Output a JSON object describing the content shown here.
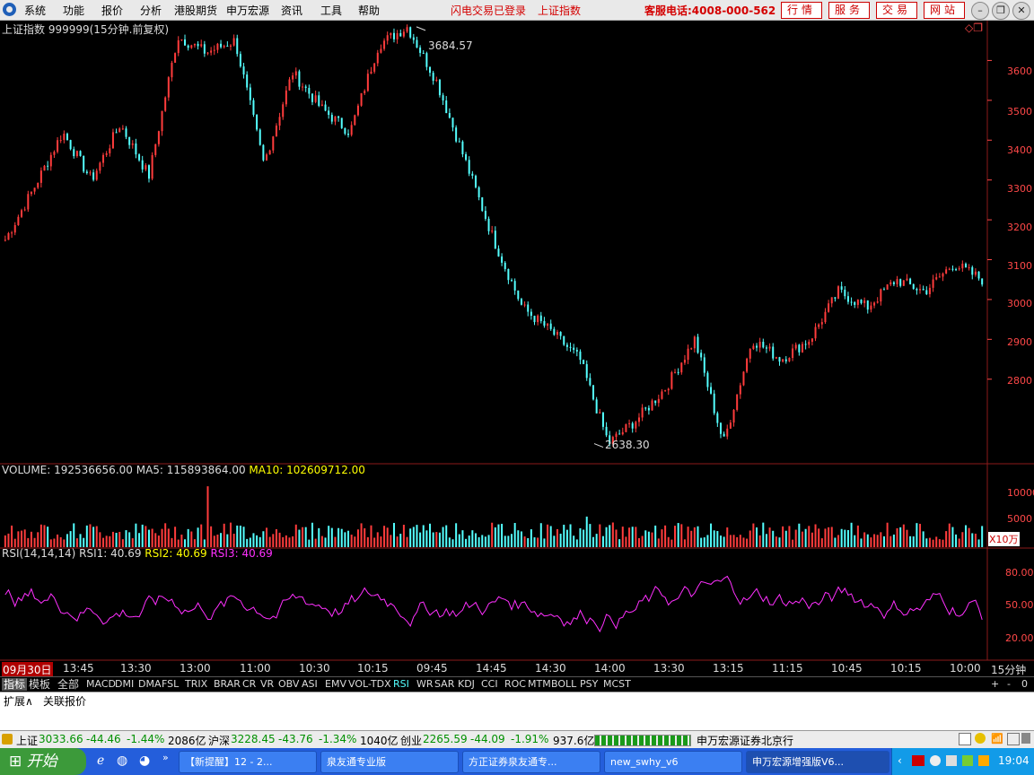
{
  "menubar": {
    "items": [
      "系统",
      "功能",
      "报价",
      "分析",
      "港股期货",
      "申万宏源",
      "资讯",
      "工具",
      "帮助"
    ],
    "status": "闪电交易已登录",
    "index_link": "上证指数",
    "hotline": "客服电话:4008-000-562",
    "buttons": [
      "行情",
      "服务",
      "交易",
      "网站"
    ]
  },
  "chart": {
    "title": "上证指数 999999(15分钟.前复权)",
    "high_label": "3684.57",
    "low_label": "2638.30",
    "y_ticks": [
      "3600",
      "3500",
      "3400",
      "3300",
      "3200",
      "3100",
      "3000",
      "2900",
      "2800"
    ]
  },
  "volume": {
    "stats": [
      "VOLUME: 192536656.00",
      "MA5: 115893864.00",
      "MA10: 102609712.00"
    ],
    "y_ticks": [
      "10000",
      "5000"
    ],
    "unit": "X10万"
  },
  "rsi": {
    "stats": [
      "RSI(14,14,14)",
      "RSI1: 40.69",
      "RSI2: 40.69",
      "RSI3: 40.69"
    ],
    "y_ticks": [
      "80.00",
      "50.00",
      "20.00"
    ]
  },
  "time_axis": {
    "labels": [
      "09月30日",
      "13:45",
      "13:30",
      "13:00",
      "11:00",
      "10:30",
      "10:15",
      "09:45",
      "14:45",
      "14:30",
      "14:00",
      "13:30",
      "13:15",
      "11:15",
      "10:45",
      "10:15",
      "10:00"
    ],
    "period": "15分钟"
  },
  "indicator_tabs": [
    "指标",
    "模板",
    "全部",
    "MACD",
    "DMI",
    "DMA",
    "FSL",
    "TRIX",
    "BRAR",
    "CR",
    "VR",
    "OBV",
    "ASI",
    "EMV",
    "VOL-TDX",
    "RSI",
    "WR",
    "SAR",
    "KDJ",
    "CCI",
    "ROC",
    "MTM",
    "BOLL",
    "PSY",
    "MCST"
  ],
  "tab_controls": [
    "+",
    "-",
    "0"
  ],
  "extension": [
    "扩展∧",
    "关联报价"
  ],
  "status_bar": {
    "sh_label": "上证",
    "sh_value": "3033.66",
    "sh_change": "-44.46",
    "sh_pct": "-1.44%",
    "sh_amount": "2086亿",
    "sz_label": "沪深",
    "sz_value": "3228.45",
    "sz_change": "-43.76",
    "sz_pct": "-1.34%",
    "sz_amount": "1040亿",
    "cy_label": "创业",
    "cy_value": "2265.59",
    "cy_change": "-44.09",
    "cy_pct": "-1.91%",
    "cy_amount": "937.6亿",
    "broker": "申万宏源证券北京行"
  },
  "taskbar": {
    "start": "开始",
    "tasks": [
      "【新提醒】12 - 2...",
      "泉友通专业版",
      "方正证券泉友通专...",
      "new_swhy_v6",
      "申万宏源增强版V6..."
    ],
    "clock": "19:04"
  },
  "chart_data": {
    "type": "candlestick",
    "title": "上证指数 999999(15分钟.前复权)",
    "ylim": [
      2590,
      3700
    ],
    "marked_high": 3684.57,
    "marked_low": 2638.3,
    "approx_path_anchors": [
      3150,
      3280,
      3420,
      3300,
      3440,
      3310,
      3660,
      3620,
      3650,
      3340,
      3570,
      3480,
      3420,
      3640,
      3684.57,
      3550,
      3350,
      3150,
      2980,
      2920,
      2850,
      2638.3,
      2700,
      2780,
      2900,
      2640,
      2900,
      2850,
      2900,
      3020,
      2980,
      3050,
      3020,
      3090,
      3050
    ],
    "volume_ylim": [
      0,
      15000
    ],
    "rsi_ylim": [
      10,
      95
    ],
    "rsi_last": 40.69
  },
  "colors": {
    "up": "#ff3c3c",
    "down": "#54ffff",
    "ma5": "#ffffff",
    "ma10": "#ffff00",
    "rsi": "#ff30ff",
    "axis": "#ff4848",
    "grid": "#8b1a1a"
  }
}
